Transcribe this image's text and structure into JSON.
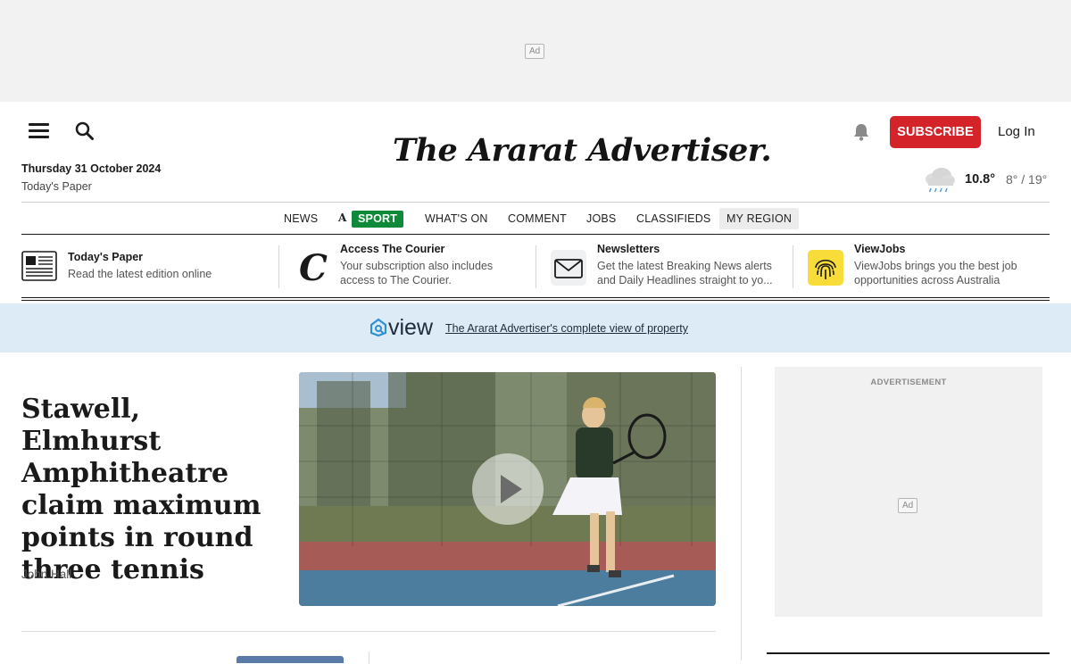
{
  "top_ad": {
    "label": "Ad"
  },
  "header": {
    "date": "Thursday 31 October 2024",
    "todays_paper_link": "Today's Paper",
    "masthead": "The Ararat Advertiser.",
    "subscribe_label": "SUBSCRIBE",
    "login_label": "Log In",
    "weather": {
      "current": "10.8°",
      "range": "8° / 19°",
      "icon": "rain-cloud-icon"
    }
  },
  "nav": {
    "items": [
      {
        "label": "NEWS"
      },
      {
        "label": "SPORT"
      },
      {
        "label": "WHAT'S ON"
      },
      {
        "label": "COMMENT"
      },
      {
        "label": "JOBS"
      },
      {
        "label": "CLASSIFIEDS"
      },
      {
        "label": "MY REGION"
      }
    ],
    "masthead_glyph": "A",
    "sport_color": "#0f8a3b"
  },
  "promos": [
    {
      "title": "Today's Paper",
      "desc": "Read the latest edition online",
      "icon": "newspaper-icon"
    },
    {
      "title": "Access The Courier",
      "desc": "Your subscription also includes access to The Courier.",
      "icon": "courier-logo-icon"
    },
    {
      "title": "Newsletters",
      "desc": "Get the latest Breaking News alerts and Daily Headlines straight to yo...",
      "icon": "envelope-icon"
    },
    {
      "title": "ViewJobs",
      "desc": "ViewJobs brings you the best job opportunities across Australia",
      "icon": "fingerprint-icon"
    }
  ],
  "view_banner": {
    "logo": "view",
    "link": "The Ararat Advertiser's complete view of property"
  },
  "article": {
    "headline": "Stawell, Elmhurst Amphitheatre claim maximum points in round three tennis",
    "byline": "John Hall"
  },
  "sidebar_ad": {
    "label": "ADVERTISEMENT",
    "tag": "Ad"
  },
  "colors": {
    "subscribe": "#d4242a",
    "banner": "#dcebf6",
    "sport": "#0f8a3b"
  }
}
